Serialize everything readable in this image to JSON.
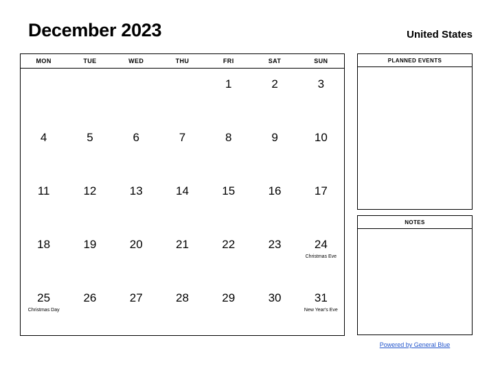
{
  "header": {
    "title": "December 2023",
    "country": "United States"
  },
  "calendar": {
    "weekday_headers": [
      "MON",
      "TUE",
      "WED",
      "THU",
      "FRI",
      "SAT",
      "SUN"
    ],
    "weeks": [
      [
        {
          "day": "",
          "event": ""
        },
        {
          "day": "",
          "event": ""
        },
        {
          "day": "",
          "event": ""
        },
        {
          "day": "",
          "event": ""
        },
        {
          "day": "1",
          "event": ""
        },
        {
          "day": "2",
          "event": ""
        },
        {
          "day": "3",
          "event": ""
        }
      ],
      [
        {
          "day": "4",
          "event": ""
        },
        {
          "day": "5",
          "event": ""
        },
        {
          "day": "6",
          "event": ""
        },
        {
          "day": "7",
          "event": ""
        },
        {
          "day": "8",
          "event": ""
        },
        {
          "day": "9",
          "event": ""
        },
        {
          "day": "10",
          "event": ""
        }
      ],
      [
        {
          "day": "11",
          "event": ""
        },
        {
          "day": "12",
          "event": ""
        },
        {
          "day": "13",
          "event": ""
        },
        {
          "day": "14",
          "event": ""
        },
        {
          "day": "15",
          "event": ""
        },
        {
          "day": "16",
          "event": ""
        },
        {
          "day": "17",
          "event": ""
        }
      ],
      [
        {
          "day": "18",
          "event": ""
        },
        {
          "day": "19",
          "event": ""
        },
        {
          "day": "20",
          "event": ""
        },
        {
          "day": "21",
          "event": ""
        },
        {
          "day": "22",
          "event": ""
        },
        {
          "day": "23",
          "event": ""
        },
        {
          "day": "24",
          "event": "Christmas Eve"
        }
      ],
      [
        {
          "day": "25",
          "event": "Christmas Day"
        },
        {
          "day": "26",
          "event": ""
        },
        {
          "day": "27",
          "event": ""
        },
        {
          "day": "28",
          "event": ""
        },
        {
          "day": "29",
          "event": ""
        },
        {
          "day": "30",
          "event": ""
        },
        {
          "day": "31",
          "event": "New Year's Eve"
        }
      ]
    ]
  },
  "panels": {
    "planned_events": {
      "title": "PLANNED EVENTS",
      "content": ""
    },
    "notes": {
      "title": "NOTES",
      "content": ""
    }
  },
  "footer": {
    "link_text": "Powered by General Blue",
    "link_color": "#2255cc"
  }
}
